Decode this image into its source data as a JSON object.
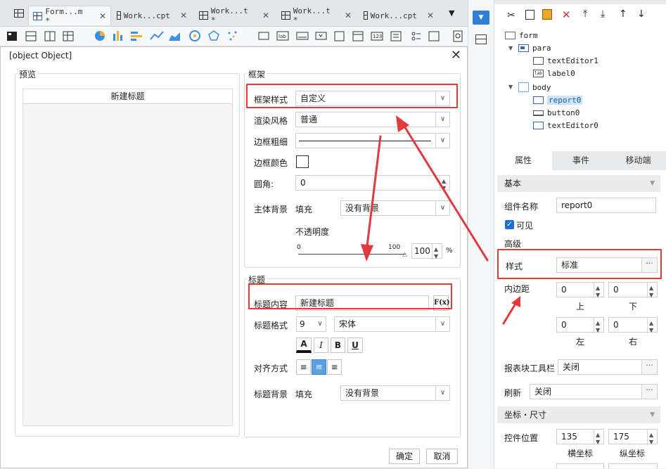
{
  "tabs": [
    {
      "label": "Form...m *",
      "active": true
    },
    {
      "label": "Work...cpt",
      "active": false
    },
    {
      "label": "Work...t *",
      "active": false
    },
    {
      "label": "Work...t *",
      "active": false
    },
    {
      "label": "Work...cpt",
      "active": false
    }
  ],
  "dialog": {
    "title": {
      "group": "标题",
      "content_label": "标题内容",
      "content_value": "新建标题",
      "formula_btn": "F(x)",
      "format_label": "标题格式",
      "font_size": "9",
      "font_name": "宋体",
      "align_label": "对齐方式",
      "bg_label": "标题背景",
      "bg_fill": "填充",
      "bg_value": "没有背景"
    },
    "preview": {
      "group": "预览",
      "title_text": "新建标题"
    },
    "frame": {
      "group": "框架",
      "style_label": "框架样式",
      "style_value": "自定义",
      "render_label": "渲染风格",
      "render_value": "普通",
      "border_width_label": "边框粗细",
      "border_color_label": "边框颜色",
      "radius_label": "圆角:",
      "radius_value": "0",
      "bg_label": "主体背景",
      "bg_fill": "填充",
      "bg_value": "没有背景",
      "opacity_label": "不透明度",
      "opacity_min": "0",
      "opacity_max": "100",
      "opacity_value": "100",
      "opacity_unit": "%"
    },
    "ok": "确定",
    "cancel": "取消"
  },
  "tree": {
    "root": "form",
    "para": "para",
    "para_children": [
      "textEditor1",
      "label0"
    ],
    "body": "body",
    "body_children": [
      "report0",
      "button0",
      "textEditor0"
    ],
    "label_icon_text": "lab"
  },
  "props": {
    "tabs": [
      "属性",
      "事件",
      "移动端"
    ],
    "basic": "基本",
    "name_label": "组件名称",
    "name_value": "report0",
    "visible_label": "可见",
    "advanced": "高级",
    "style_label": "样式",
    "style_value": "标准",
    "padding_label": "内边距",
    "pad_top": "0",
    "pad_bottom": "0",
    "pad_left": "0",
    "pad_right": "0",
    "top_label": "上",
    "bottom_label": "下",
    "left_label": "左",
    "right_label": "右",
    "toolbar_label": "报表块工具栏",
    "toolbar_value": "关闭",
    "refresh_label": "刷新",
    "refresh_value": "关闭",
    "coord_section": "坐标・尺寸",
    "pos_label": "控件位置",
    "pos_x": "135",
    "pos_y": "175",
    "x_label": "横坐标",
    "y_label": "纵坐标"
  },
  "colors": {
    "accent": "#1e6fd9",
    "annotation": "#e4393c"
  }
}
